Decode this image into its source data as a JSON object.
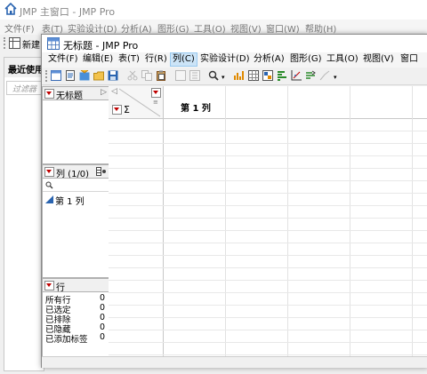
{
  "back_window": {
    "title": "JMP 主窗口 - JMP Pro",
    "menu": [
      "文件(F)",
      "表(T)",
      "实验设计(D)",
      "分析(A)",
      "图形(G)",
      "工具(O)",
      "视图(V)",
      "窗口(W)",
      "帮助(H)"
    ],
    "toolbar_new_label": "新建",
    "recent_heading": "最近使用",
    "filter_placeholder": "过滤器"
  },
  "front_window": {
    "title": "无标题 - JMP Pro",
    "menu": [
      "文件(F)",
      "编辑(E)",
      "表(T)",
      "行(R)",
      "列(C)",
      "实验设计(D)",
      "分析(A)",
      "图形(G)",
      "工具(O)",
      "视图(V)",
      "窗口"
    ],
    "selected_menu_index": 4,
    "table_panel": {
      "title": "无标题"
    },
    "columns_panel": {
      "title": "列 (1/0)",
      "search_icon": "search-icon",
      "items": [
        "第 1 列"
      ]
    },
    "rows_panel": {
      "title": "行",
      "items": [
        {
          "label": "所有行",
          "value": "0"
        },
        {
          "label": "已选定",
          "value": "0"
        },
        {
          "label": "已排除",
          "value": "0"
        },
        {
          "label": "已隐藏",
          "value": "0"
        },
        {
          "label": "已添加标签",
          "value": "0"
        }
      ]
    },
    "grid": {
      "sigma": "Σ",
      "column_header": "第 1 列"
    }
  },
  "colors": {
    "accent_red": "#c00000",
    "menu_highlight": "#cce4f7",
    "border": "#b0b0b0"
  }
}
